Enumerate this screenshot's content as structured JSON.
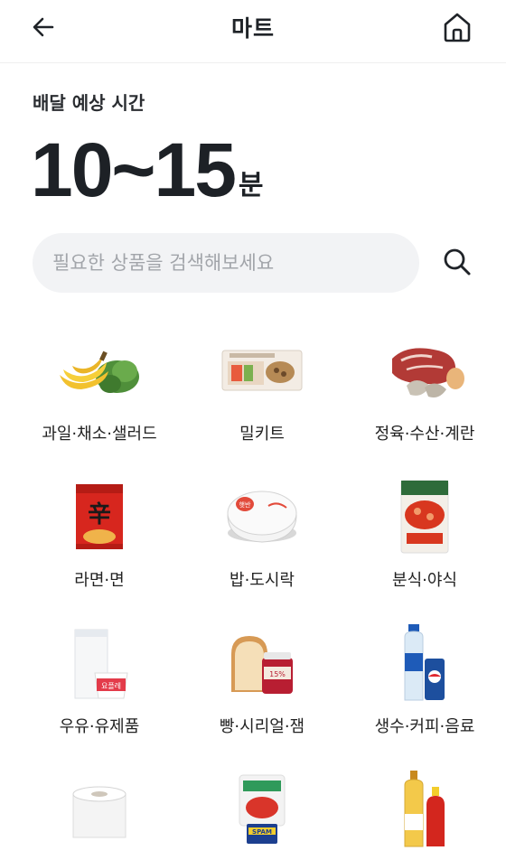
{
  "header": {
    "title": "마트",
    "back_icon": "arrow-left-icon",
    "home_icon": "home-icon"
  },
  "eta": {
    "label": "배달 예상 시간",
    "value": "10~15",
    "unit": "분"
  },
  "search": {
    "placeholder": "필요한 상품을 검색해보세요",
    "value": "",
    "icon": "search-icon"
  },
  "categories": [
    {
      "label": "과일·채소·샐러드",
      "icon": "fruit-vegetable-icon"
    },
    {
      "label": "밀키트",
      "icon": "meal-kit-icon"
    },
    {
      "label": "정육·수산·계란",
      "icon": "meat-seafood-egg-icon"
    },
    {
      "label": "라면·면",
      "icon": "ramen-icon"
    },
    {
      "label": "밥·도시락",
      "icon": "rice-bowl-icon"
    },
    {
      "label": "분식·야식",
      "icon": "snack-food-icon"
    },
    {
      "label": "우유·유제품",
      "icon": "milk-dairy-icon"
    },
    {
      "label": "빵·시리얼·잼",
      "icon": "bread-jam-icon"
    },
    {
      "label": "생수·커피·음료",
      "icon": "water-drink-icon"
    },
    {
      "label": "",
      "icon": "toilet-paper-icon"
    },
    {
      "label": "",
      "icon": "kimchi-spam-icon"
    },
    {
      "label": "",
      "icon": "oil-sauce-icon"
    }
  ],
  "colors": {
    "text": "#1f2328",
    "search_bg": "#f2f3f5",
    "placeholder": "#a2a5aa"
  }
}
